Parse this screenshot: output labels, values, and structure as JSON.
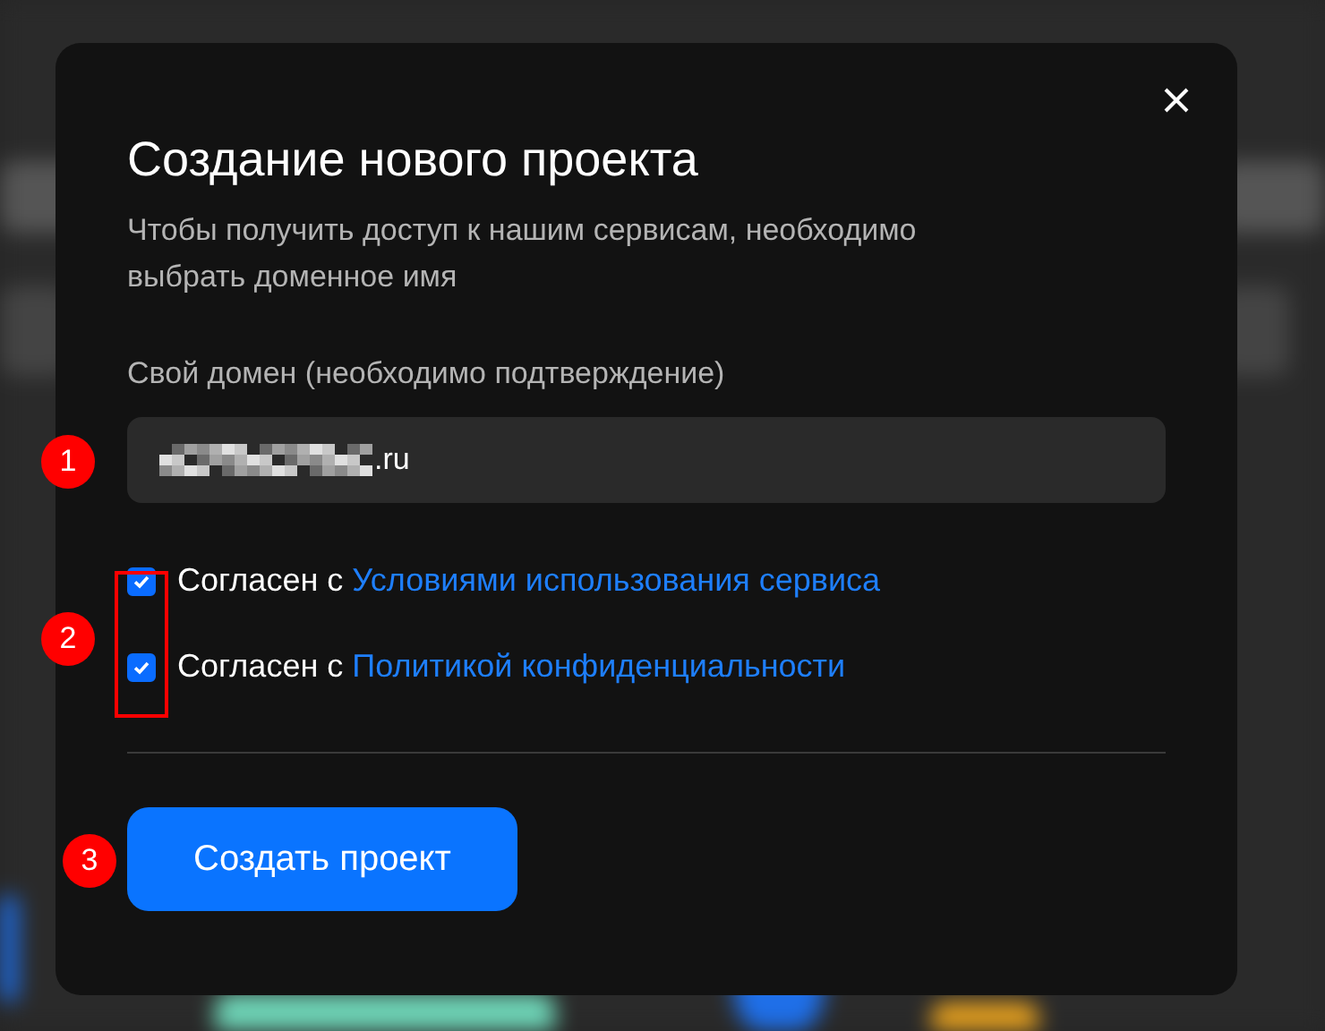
{
  "dialog": {
    "title": "Создание нового проекта",
    "description": "Чтобы получить доступ к нашим сервисам, необходимо выбрать доменное имя",
    "domain_field": {
      "label": "Свой домен (необходимо подтверждение)",
      "value": ".ru",
      "redacted": true
    },
    "agreements": [
      {
        "checked": true,
        "text": "Согласен с",
        "link": "Условиями использования сервиса"
      },
      {
        "checked": true,
        "text": "Согласен с",
        "link": "Политикой конфиденциальности"
      }
    ],
    "submit_button": "Создать проект"
  },
  "annotations": [
    {
      "label": "1"
    },
    {
      "label": "2"
    },
    {
      "label": "3"
    }
  ]
}
